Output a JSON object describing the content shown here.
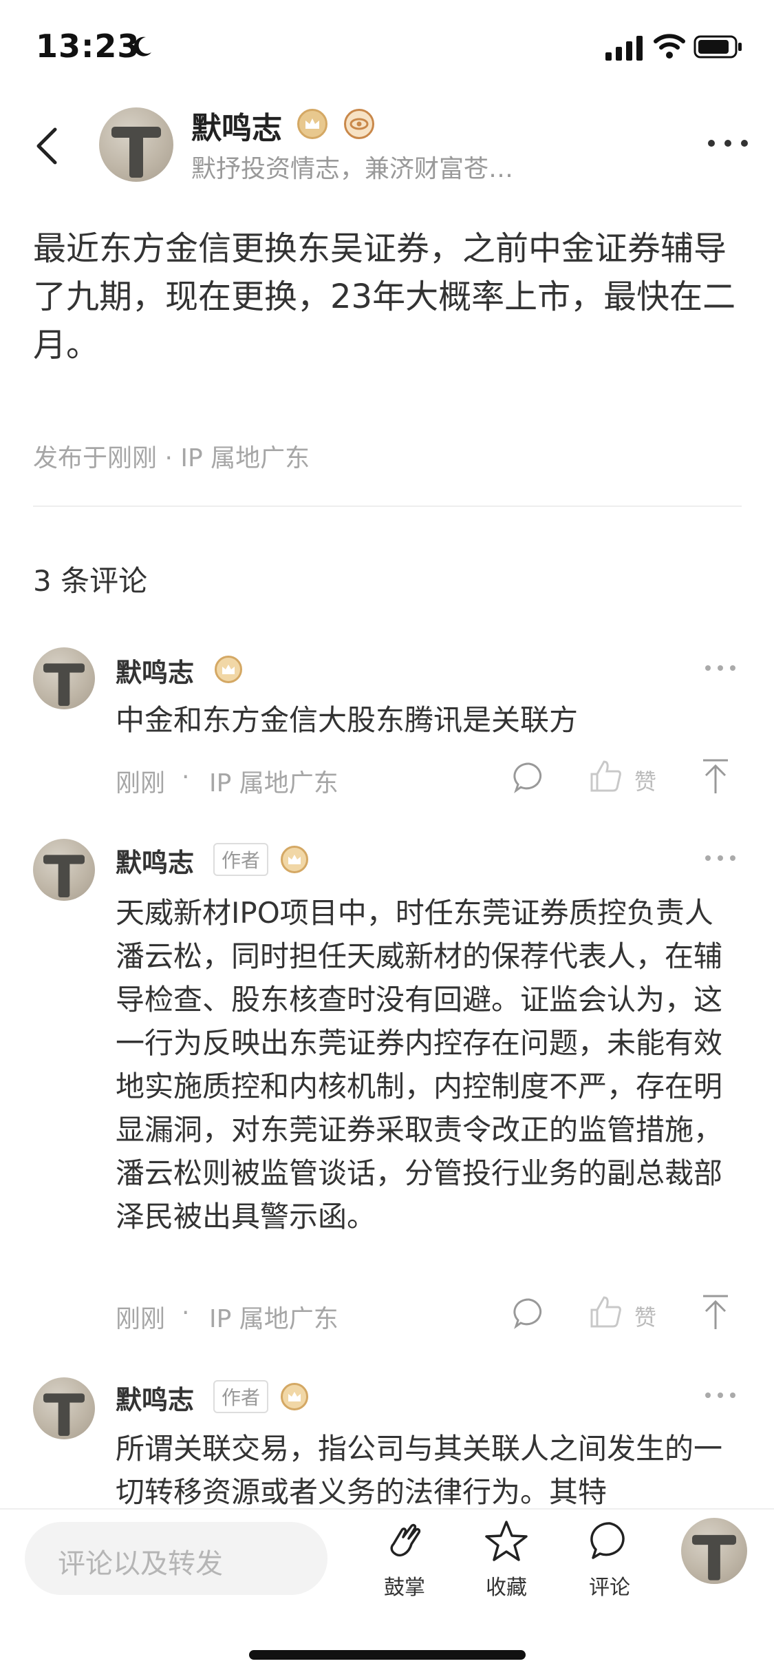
{
  "status_bar": {
    "time": "13:23"
  },
  "header": {
    "author_name": "默鸣志",
    "author_subtitle": "默抒投资情志，兼济财富苍…"
  },
  "post": {
    "body": "最近东方金信更换东吴证券，之前中金证券辅导了九期，现在更换，23年大概率上市，最快在二月。",
    "meta": "发布于刚刚 · IP 属地广东"
  },
  "comments_title": "3 条评论",
  "comments": [
    {
      "name": "默鸣志",
      "text": "中金和东方金信大股东腾讯是关联方",
      "time": "刚刚",
      "ip": "IP 属地广东",
      "like_label": "赞"
    },
    {
      "name": "默鸣志",
      "tag": "作者",
      "text": "天威新材IPO项目中，时任东莞证券质控负责人潘云松，同时担任天威新材的保荐代表人，在辅导检查、股东核查时没有回避。证监会认为，这一行为反映出东莞证券内控存在问题，未能有效地实施质控和内核机制，内控制度不严，存在明显漏洞，对东莞证券采取责令改正的监管措施，潘云松则被监管谈话，分管投行业务的副总裁部泽民被出具警示函。",
      "time": "刚刚",
      "ip": "IP 属地广东",
      "like_label": "赞"
    },
    {
      "name": "默鸣志",
      "tag": "作者",
      "text": "所谓关联交易，指公司与其关联人之间发生的一切转移资源或者义务的法律行为。其特"
    }
  ],
  "bottom_bar": {
    "input_placeholder": "评论以及转发",
    "clap_label": "鼓掌",
    "favorite_label": "收藏",
    "comment_label": "评论"
  },
  "colors": {
    "text": "#333333",
    "muted": "#a6a6a6",
    "badge_gold": "#d4a864"
  }
}
